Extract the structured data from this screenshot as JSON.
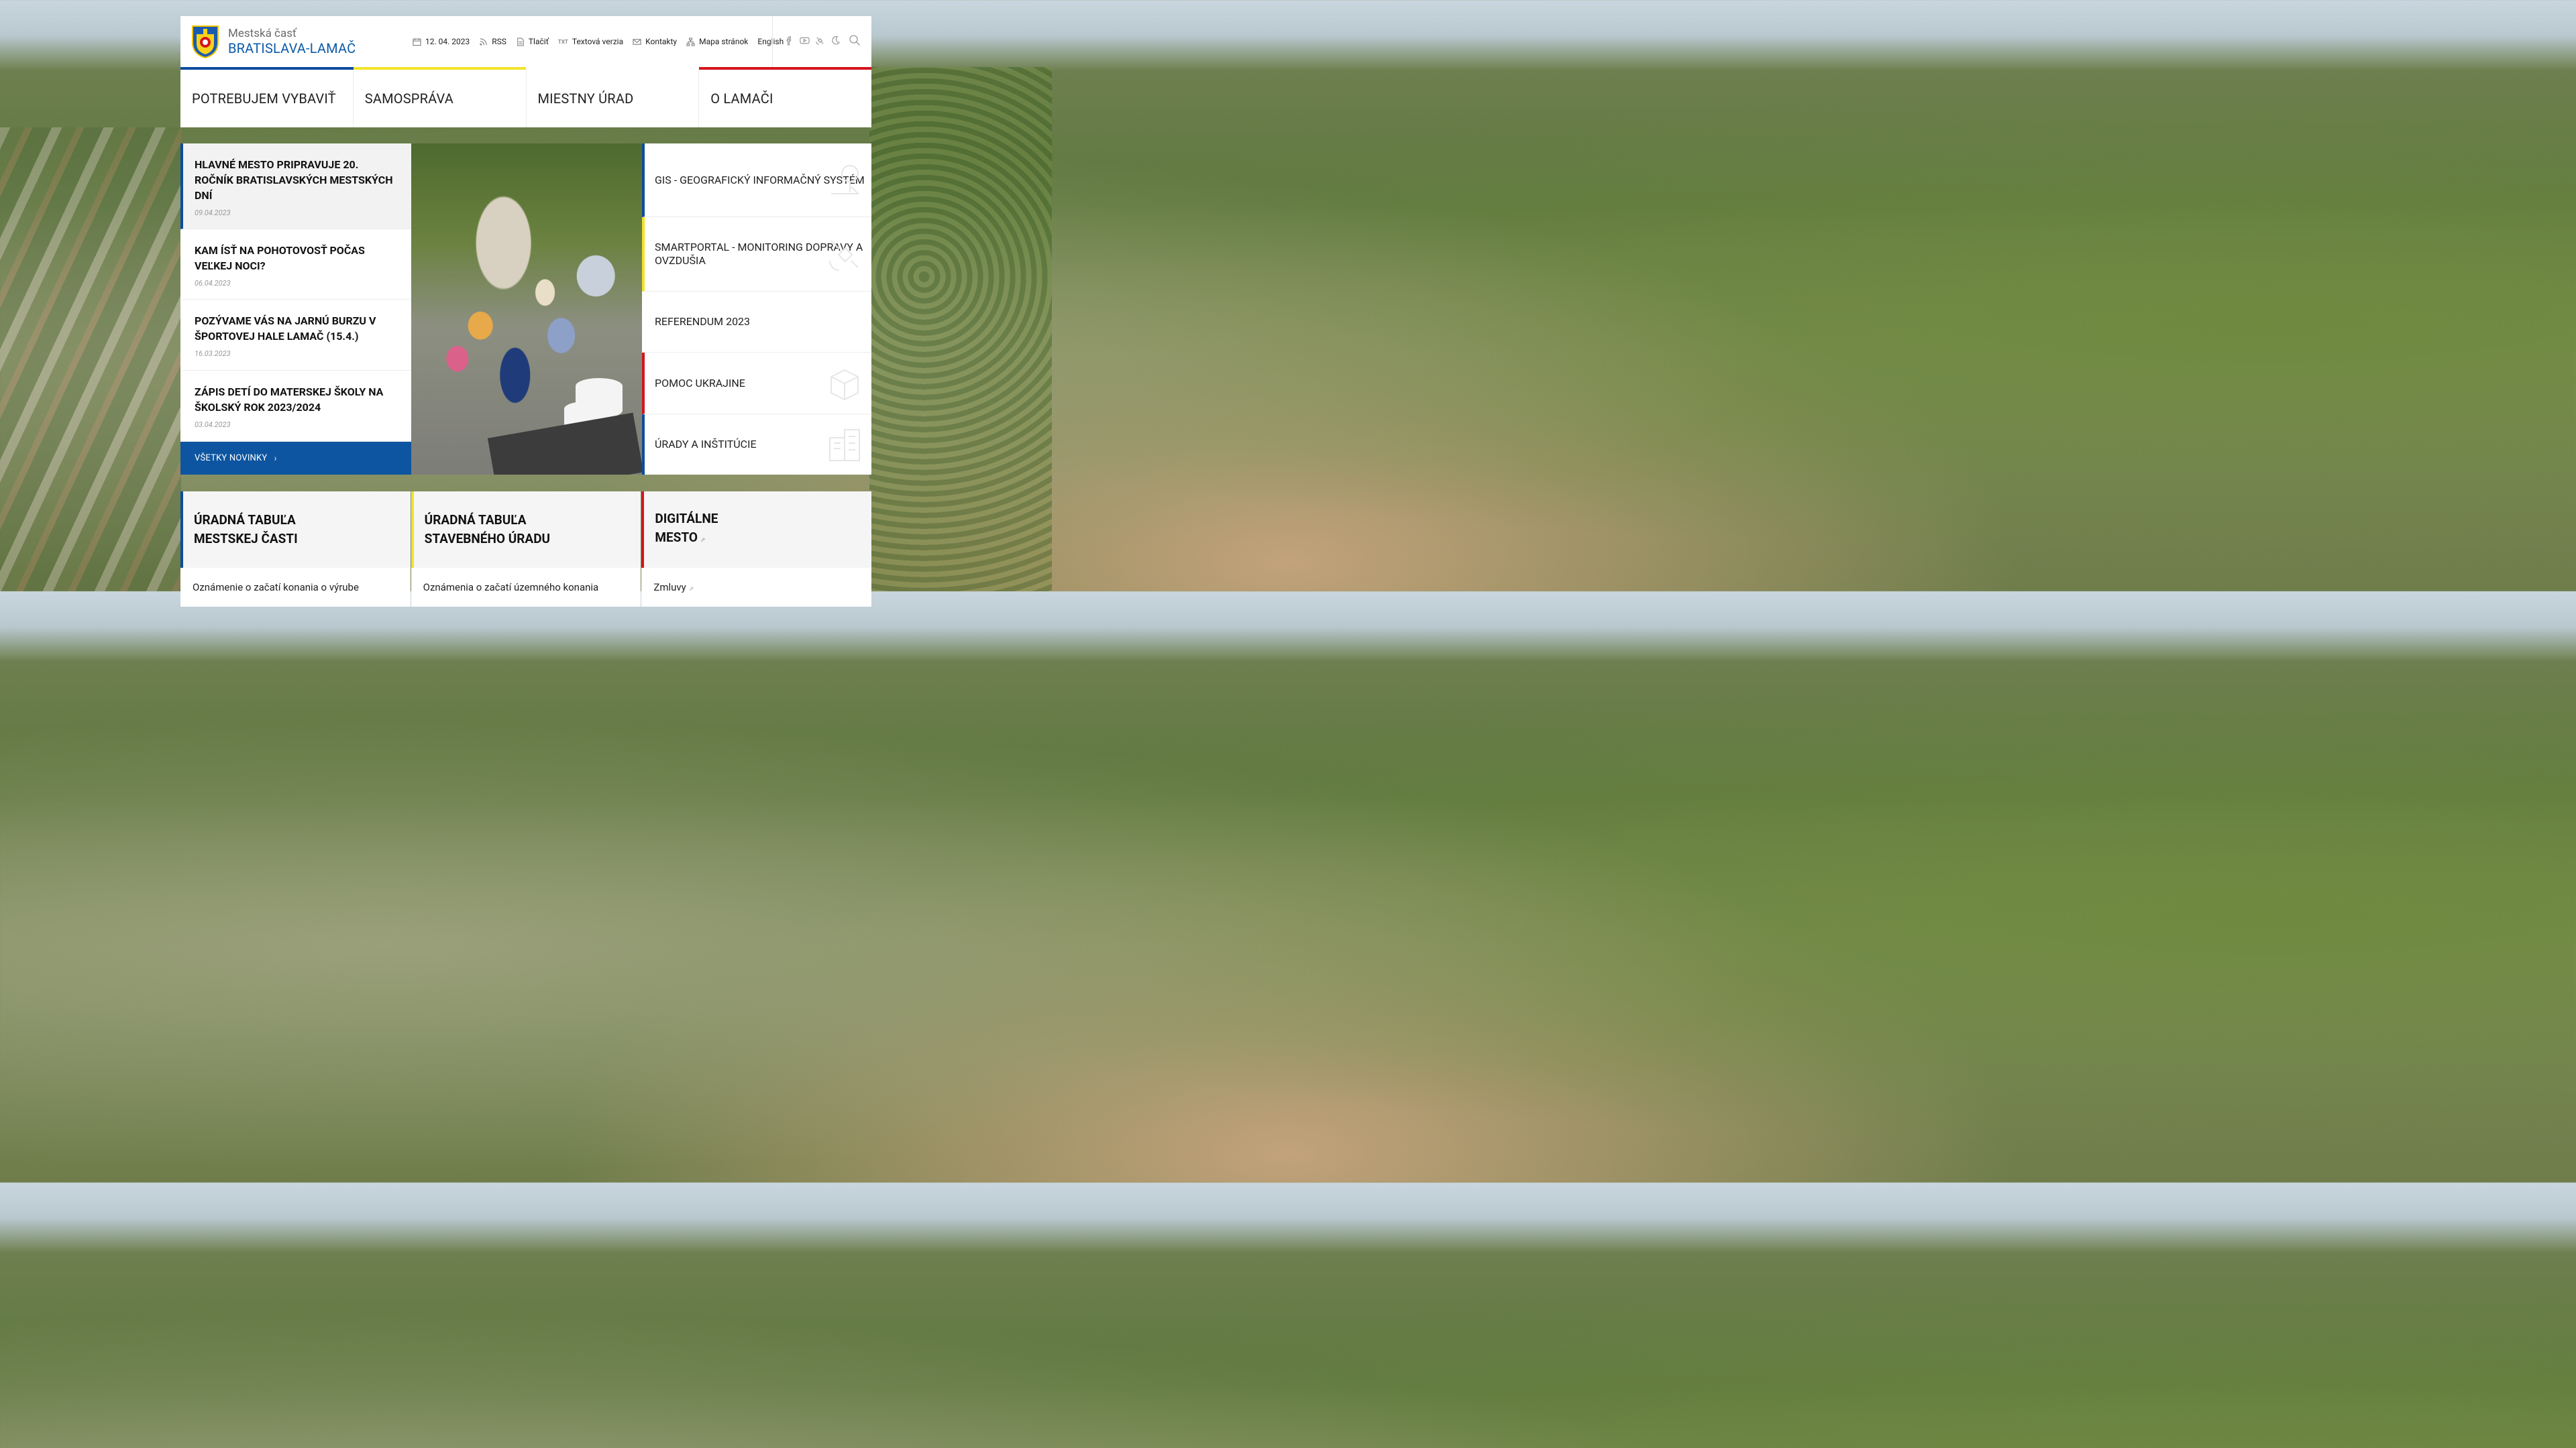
{
  "header": {
    "brand_top": "Mestská časť",
    "brand_bottom": "BRATISLAVA-LAMAČ",
    "date": "12. 04. 2023",
    "rss": "RSS",
    "print": "Tlačiť",
    "text_version_icon": "TXT",
    "text_version": "Textová verzia",
    "contacts": "Kontakty",
    "sitemap": "Mapa stránok",
    "english": "English"
  },
  "colors": {
    "blue": "#0d4d9e",
    "yellow": "#f2e32b",
    "red": "#d3161c",
    "link_blue": "#0d5aa7"
  },
  "nav": [
    {
      "label": "POTREBUJEM VYBAVIŤ",
      "color": "#0d4d9e"
    },
    {
      "label": "SAMOSPRÁVA",
      "color": "#f2e32b"
    },
    {
      "label": "MIESTNY ÚRAD",
      "color": "#ffffff"
    },
    {
      "label": "O LAMAČI",
      "color": "#d3161c"
    }
  ],
  "news": {
    "items": [
      {
        "title": "HLAVNÉ MESTO PRIPRAVUJE 20. ROČNÍK BRATISLAVSKÝCH MESTSKÝCH DNÍ",
        "date": "09.04.2023"
      },
      {
        "title": "KAM ÍSŤ NA POHOTOVOSŤ POČAS VEĽKEJ NOCI?",
        "date": "06.04.2023"
      },
      {
        "title": "POZÝVAME VÁS NA JARNÚ BURZU V ŠPORTOVEJ HALE LAMAČ (15.4.)",
        "date": "16.03.2023"
      },
      {
        "title": "ZÁPIS DETÍ DO MATERSKEJ ŠKOLY NA ŠKOLSKÝ ROK 2023/2024",
        "date": "03.04.2023"
      }
    ],
    "all_label": "VŠETKY NOVINKY"
  },
  "quick_links": [
    {
      "label": "GIS - GEOGRAFICKÝ INFORMAČNÝ SYSTÉM",
      "color": "#0d4d9e",
      "icon": "map-pin-icon"
    },
    {
      "label": "SMARTPORTAL - MONITORING DOPRAVY A OVZDUŠIA",
      "color": "#f2e32b",
      "icon": "satellite-icon"
    },
    {
      "label": "REFERENDUM 2023",
      "color": "#ffffff",
      "icon": ""
    },
    {
      "label": "POMOC UKRAJINE",
      "color": "#d3161c",
      "icon": "box-icon"
    },
    {
      "label": "ÚRADY A INŠTITÚCIE",
      "color": "#0d4d9e",
      "icon": "building-icon"
    }
  ],
  "cards": [
    {
      "line1": "ÚRADNÁ TABUĽA",
      "line2": "MESTSKEJ ČASTI",
      "color": "#0d4d9e",
      "body": "Oznámenie o začatí konania o výrube"
    },
    {
      "line1": "ÚRADNÁ TABUĽA",
      "line2": "STAVEBNÉHO ÚRADU",
      "color": "#f2e32b",
      "body": "Oznámenia o začatí územného konania"
    },
    {
      "line1": "DIGITÁLNE",
      "line2": "MESTO",
      "color": "#d3161c",
      "body": "Zmluvy"
    }
  ]
}
